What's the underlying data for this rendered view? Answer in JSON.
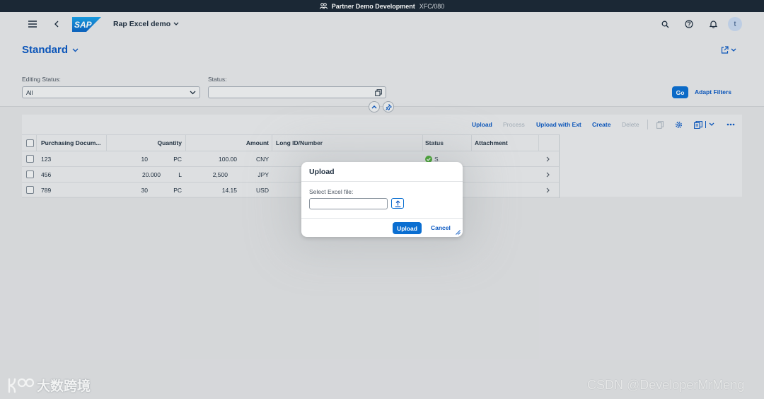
{
  "system_bar": {
    "name": "Partner Demo Development",
    "id": "XFC/080"
  },
  "shell": {
    "app_title": "Rap Excel demo",
    "logo_text": "SAP",
    "avatar_letter": "t"
  },
  "variant": {
    "name": "Standard"
  },
  "filters": {
    "editing_status": {
      "label": "Editing Status:",
      "value": "All"
    },
    "status": {
      "label": "Status:",
      "value": ""
    },
    "go_label": "Go",
    "adapt_label": "Adapt Filters"
  },
  "toolbar": {
    "upload": "Upload",
    "process": "Process",
    "upload_with_ext": "Upload with Ext",
    "create": "Create",
    "delete": "Delete"
  },
  "table": {
    "columns": {
      "purchasing_document": "Purchasing Docum...",
      "quantity": "Quantity",
      "amount": "Amount",
      "long_id": "Long ID/Number",
      "status": "Status",
      "attachment": "Attachment"
    },
    "rows": [
      {
        "doc": "123",
        "qty": "10",
        "unit": "PC",
        "amount": "100.00",
        "currency": "CNY",
        "status": "S"
      },
      {
        "doc": "456",
        "qty": "20.000",
        "unit": "L",
        "amount": "2,500",
        "currency": "JPY",
        "status": ""
      },
      {
        "doc": "789",
        "qty": "30",
        "unit": "PC",
        "amount": "14.15",
        "currency": "USD",
        "status": ""
      }
    ]
  },
  "dialog": {
    "title": "Upload",
    "field_label": "Select Excel file:",
    "upload_label": "Upload",
    "cancel_label": "Cancel"
  },
  "watermarks": {
    "left": "大数跨境",
    "right": "CSDN @DeveloperMrMeng"
  },
  "colors": {
    "accent": "#0a6ed1",
    "link": "#0a58c2",
    "shell_bar": "#1b2836",
    "success": "#36a41d"
  }
}
